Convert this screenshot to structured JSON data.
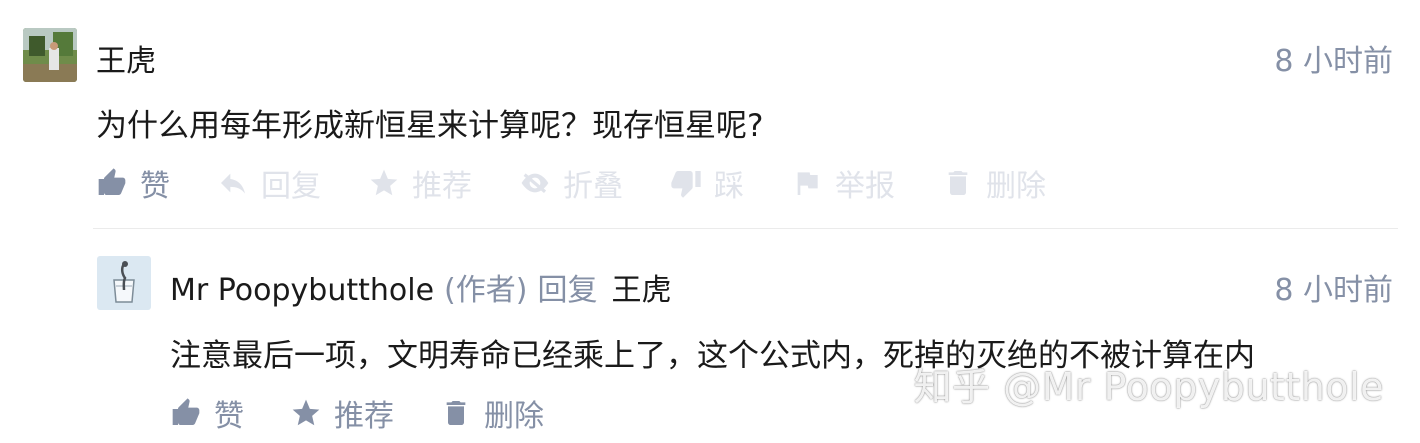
{
  "comments": [
    {
      "author": "王虎",
      "time": "8 小时前",
      "content": "为什么用每年形成新恒星来计算呢？现存恒星呢?",
      "actions": {
        "like": "赞",
        "reply": "回复",
        "recommend": "推荐",
        "fold": "折叠",
        "dislike": "踩",
        "report": "举报",
        "delete": "删除"
      }
    },
    {
      "author": "Mr Poopybutthole",
      "role": "(作者)",
      "reply_word": "回复",
      "reply_to": "王虎",
      "time": "8 小时前",
      "content": "注意最后一项，文明寿命已经乘上了，这个公式内，死掉的灭绝的不被计算在内",
      "actions": {
        "like": "赞",
        "recommend": "推荐",
        "delete": "删除"
      }
    }
  ],
  "watermark": "知乎 @Mr Poopybutthole",
  "colors": {
    "text": "#1a1a1a",
    "muted": "#8590a6",
    "faded": "#e0e3ea",
    "divider": "#ebebeb"
  }
}
